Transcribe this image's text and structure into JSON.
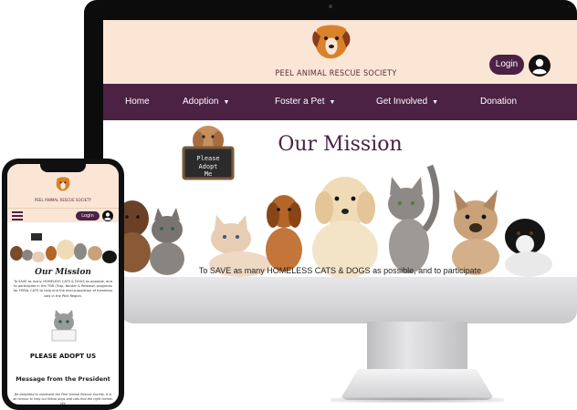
{
  "site": {
    "name": "PEEL ANIMAL RESCUE SOCIETY",
    "login_label": "Login"
  },
  "desktop": {
    "nav": [
      {
        "label": "Home",
        "has_dropdown": false
      },
      {
        "label": "Adoption",
        "has_dropdown": true
      },
      {
        "label": "Foster a Pet",
        "has_dropdown": true
      },
      {
        "label": "Get Involved",
        "has_dropdown": true
      },
      {
        "label": "Donation",
        "has_dropdown": false
      }
    ],
    "hero": {
      "title": "Our Mission",
      "sign_text": "Please Adopt Me",
      "subtitle": "To SAVE as many  HOMELESS CATS & DOGS as possible, and to participate"
    }
  },
  "mobile": {
    "login_label": "Login",
    "mission_title": "Our Mission",
    "mission_text": "To SAVE as many  HOMELESS CATS & DOGS as possible, and to participate in the TNR (Trap, Neuter & Release) programs for FERAL CATS to help end the ever-population of homeless cats in the Peel Region.",
    "adopt_label": "PLEASE ADOPT US",
    "president_title": "Message from the President",
    "president_text": "Be delighted to represent the Peel Animal Rescue Society. It is an honour to help our fellow dogs and cats find the right homes. We"
  },
  "colors": {
    "brand_purple": "#4b2144",
    "header_peach": "#fbe6d6",
    "logo_orange": "#d9822b"
  },
  "icons": [
    "dog-logo-icon",
    "user-avatar-icon",
    "hamburger-menu-icon",
    "caret-down-icon"
  ]
}
